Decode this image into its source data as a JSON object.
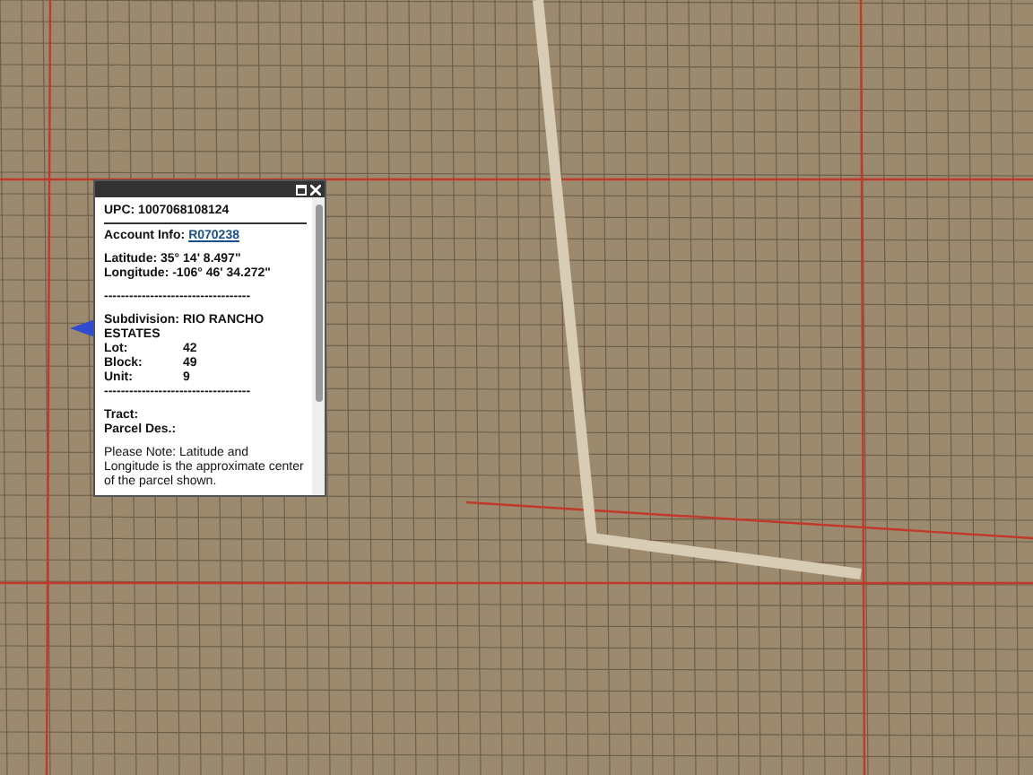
{
  "popup": {
    "upc": "UPC: 1007068108124",
    "account_label": "Account Info:",
    "account_link": "R070238",
    "latitude": "Latitude: 35° 14' 8.497\"",
    "longitude": "Longitude: -106° 46' 34.272\"",
    "separator": "-----------------------------------",
    "subdivision": "Subdivision: RIO RANCHO ESTATES",
    "fields": [
      {
        "label": "Lot:",
        "value": "42"
      },
      {
        "label": "Block:",
        "value": "49"
      },
      {
        "label": "Unit:",
        "value": "9"
      }
    ],
    "separator_2": "-----------------------------------",
    "tract": "Tract:",
    "parcel": "Parcel Des.:",
    "note": "Please Note: Latitude and Longitude is the approximate center of the parcel shown."
  }
}
